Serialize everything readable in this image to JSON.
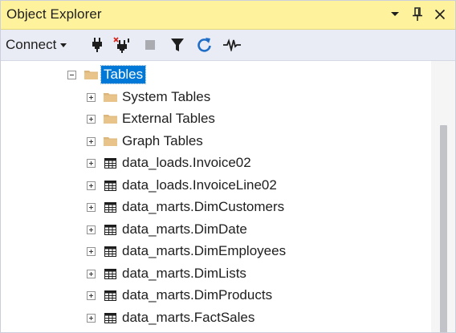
{
  "panel": {
    "title": "Object Explorer",
    "title_bar_color": "#fff29d"
  },
  "title_icons": [
    "dropdown-arrow-icon",
    "pin-icon",
    "close-icon"
  ],
  "toolbar": {
    "connect_label": "Connect",
    "tools": [
      "connect-plug-icon",
      "disconnect-plug-icon",
      "stop-icon",
      "filter-icon",
      "refresh-icon",
      "activity-monitor-icon"
    ]
  },
  "tree": {
    "root": {
      "label": "Tables",
      "expanded": true,
      "selected": true,
      "icon": "folder-icon"
    },
    "children": [
      {
        "label": "System Tables",
        "icon": "folder-icon"
      },
      {
        "label": "External Tables",
        "icon": "folder-icon"
      },
      {
        "label": "Graph Tables",
        "icon": "folder-icon"
      },
      {
        "label": "data_loads.Invoice02",
        "icon": "table-icon"
      },
      {
        "label": "data_loads.InvoiceLine02",
        "icon": "table-icon"
      },
      {
        "label": "data_marts.DimCustomers",
        "icon": "table-icon"
      },
      {
        "label": "data_marts.DimDate",
        "icon": "table-icon"
      },
      {
        "label": "data_marts.DimEmployees",
        "icon": "table-icon"
      },
      {
        "label": "data_marts.DimLists",
        "icon": "table-icon"
      },
      {
        "label": "data_marts.DimProducts",
        "icon": "table-icon"
      },
      {
        "label": "data_marts.FactSales",
        "icon": "table-icon"
      }
    ]
  },
  "colors": {
    "selection": "#0078d7",
    "folder": "#dcb67a",
    "toolbar_bg": "#e9ecf4"
  }
}
